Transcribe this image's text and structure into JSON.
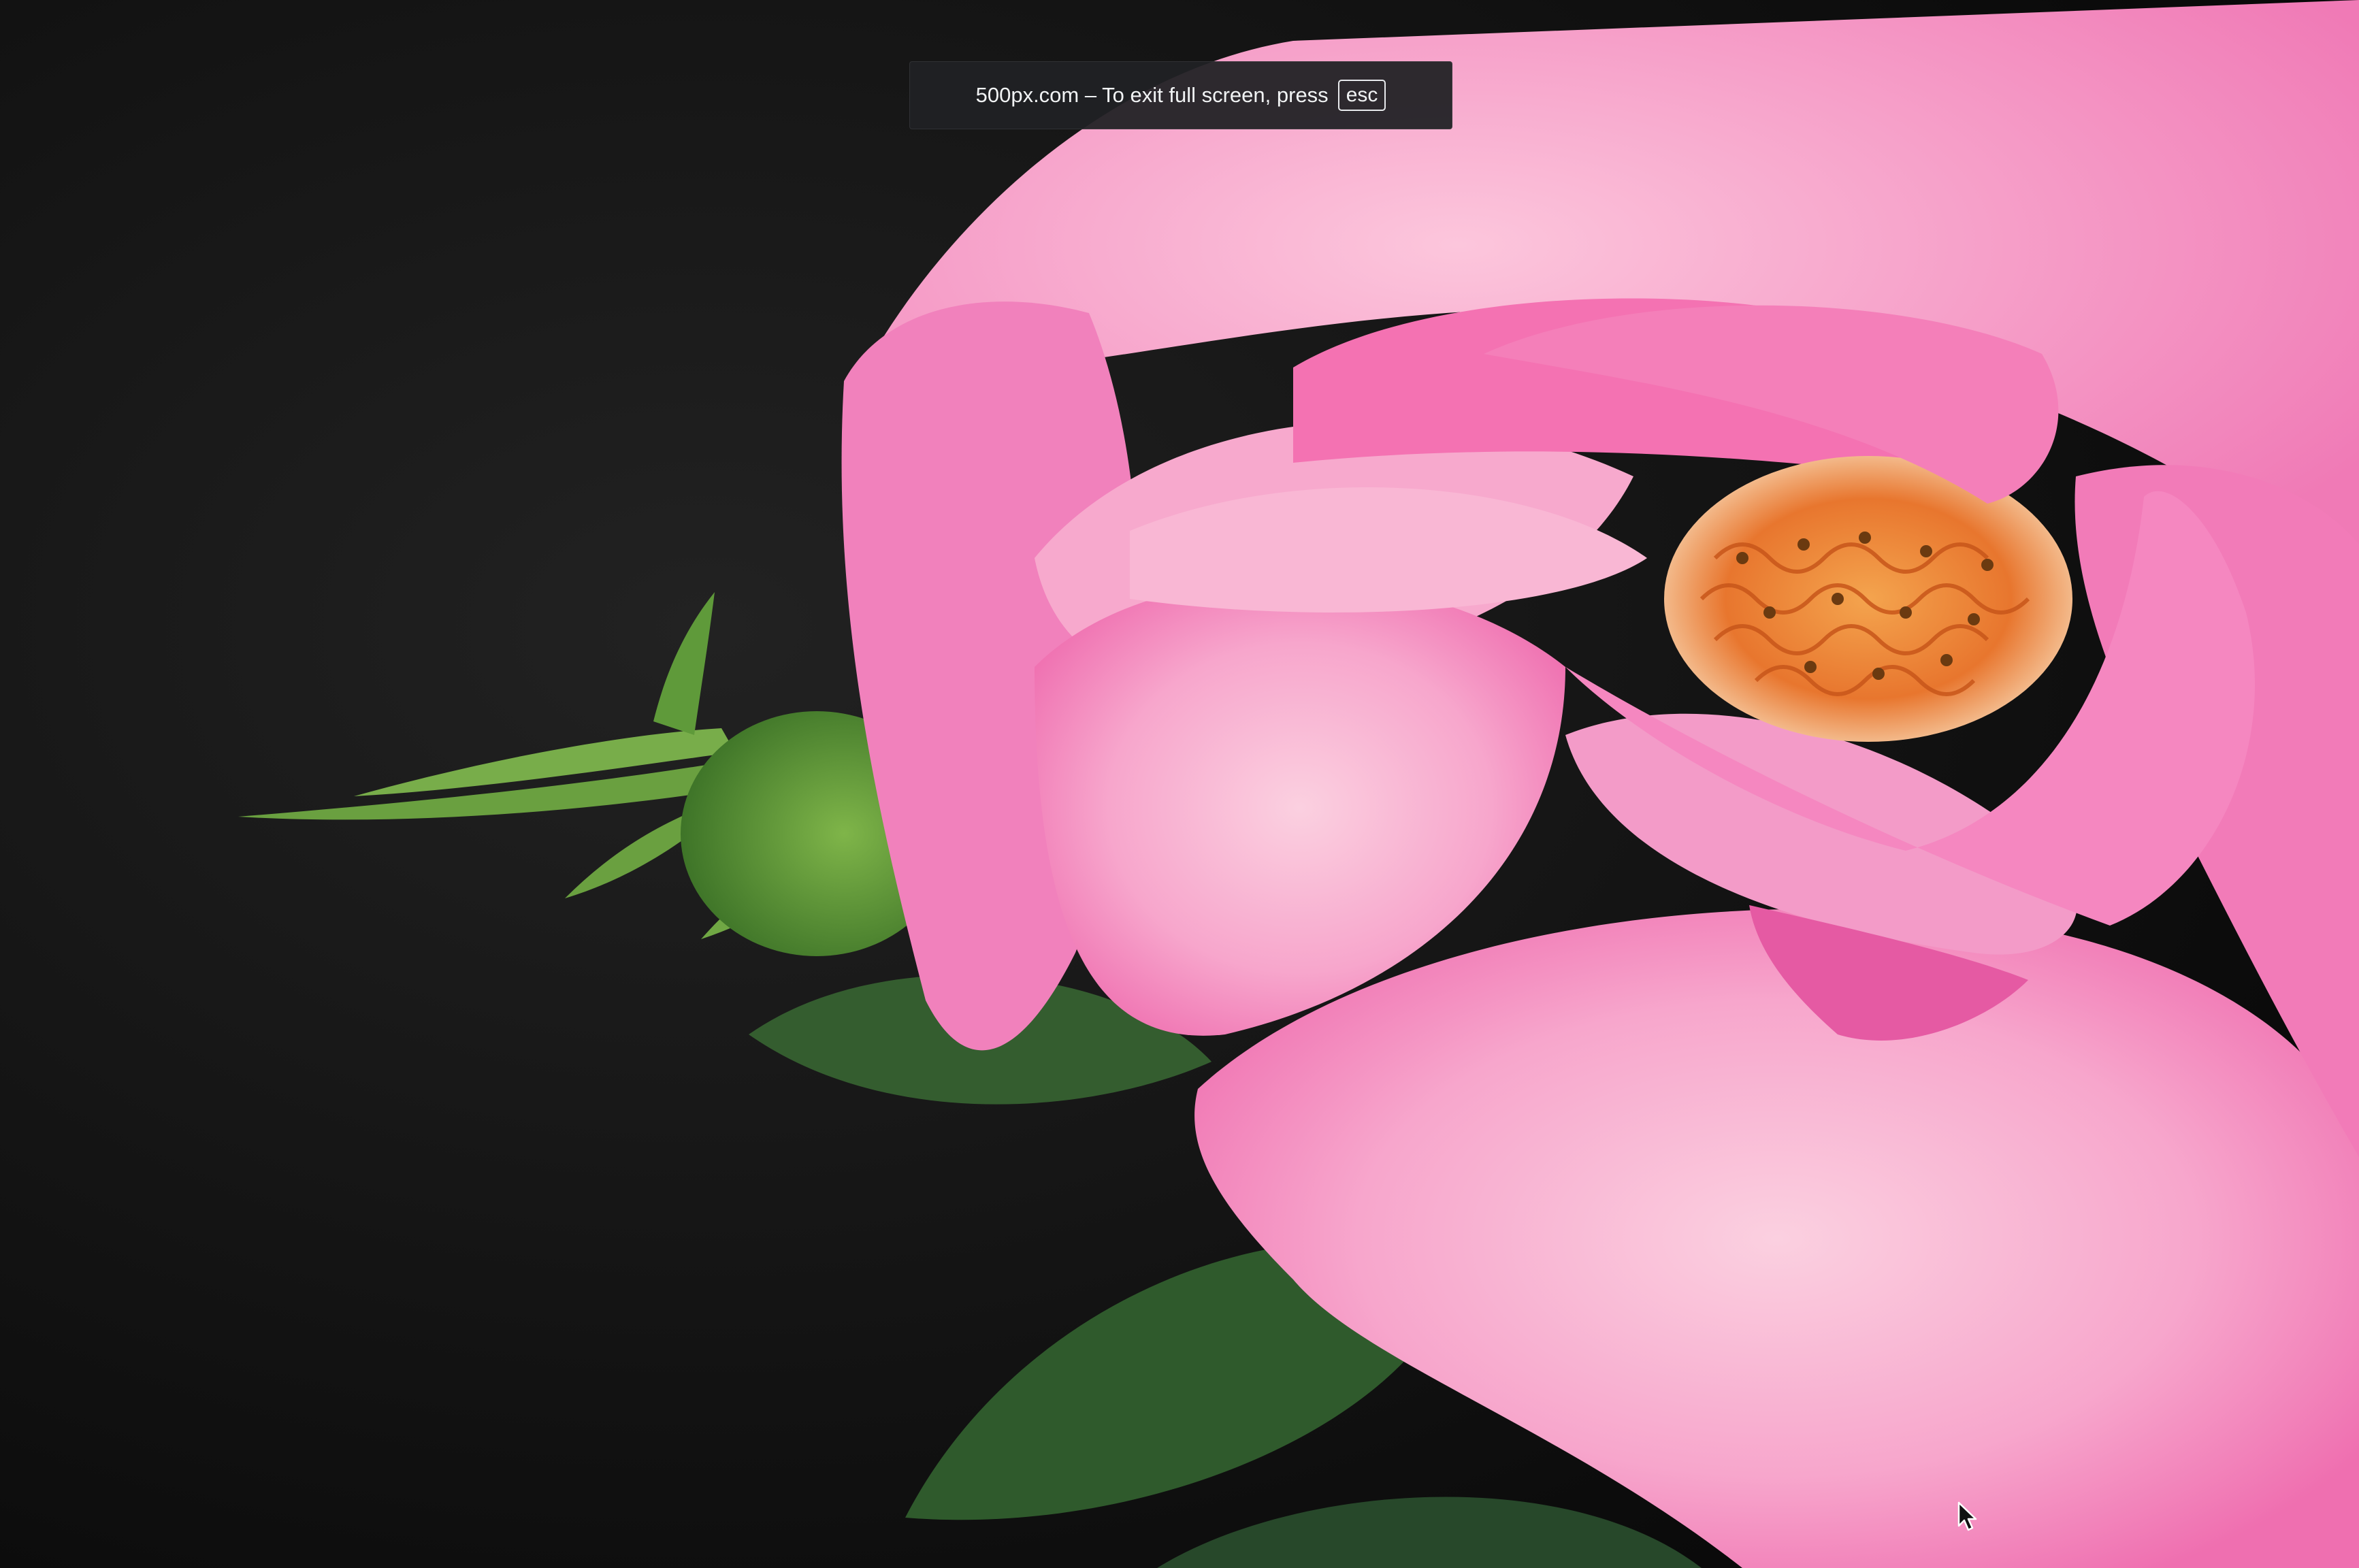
{
  "fullscreen_notice": {
    "message": "500px.com – To exit full screen, press",
    "key_label": "esc"
  },
  "photo": {
    "subject_icon": "pink-rose-photo",
    "colors": {
      "background": "#0e0e0e",
      "petal": "#f59cc8",
      "petal_deep": "#ee5fa8",
      "stamen": "#e8762e",
      "bud": "#5e9a3a",
      "leaf": "#2f5a2c"
    }
  },
  "cursor": {
    "icon": "mouse-pointer-icon"
  }
}
